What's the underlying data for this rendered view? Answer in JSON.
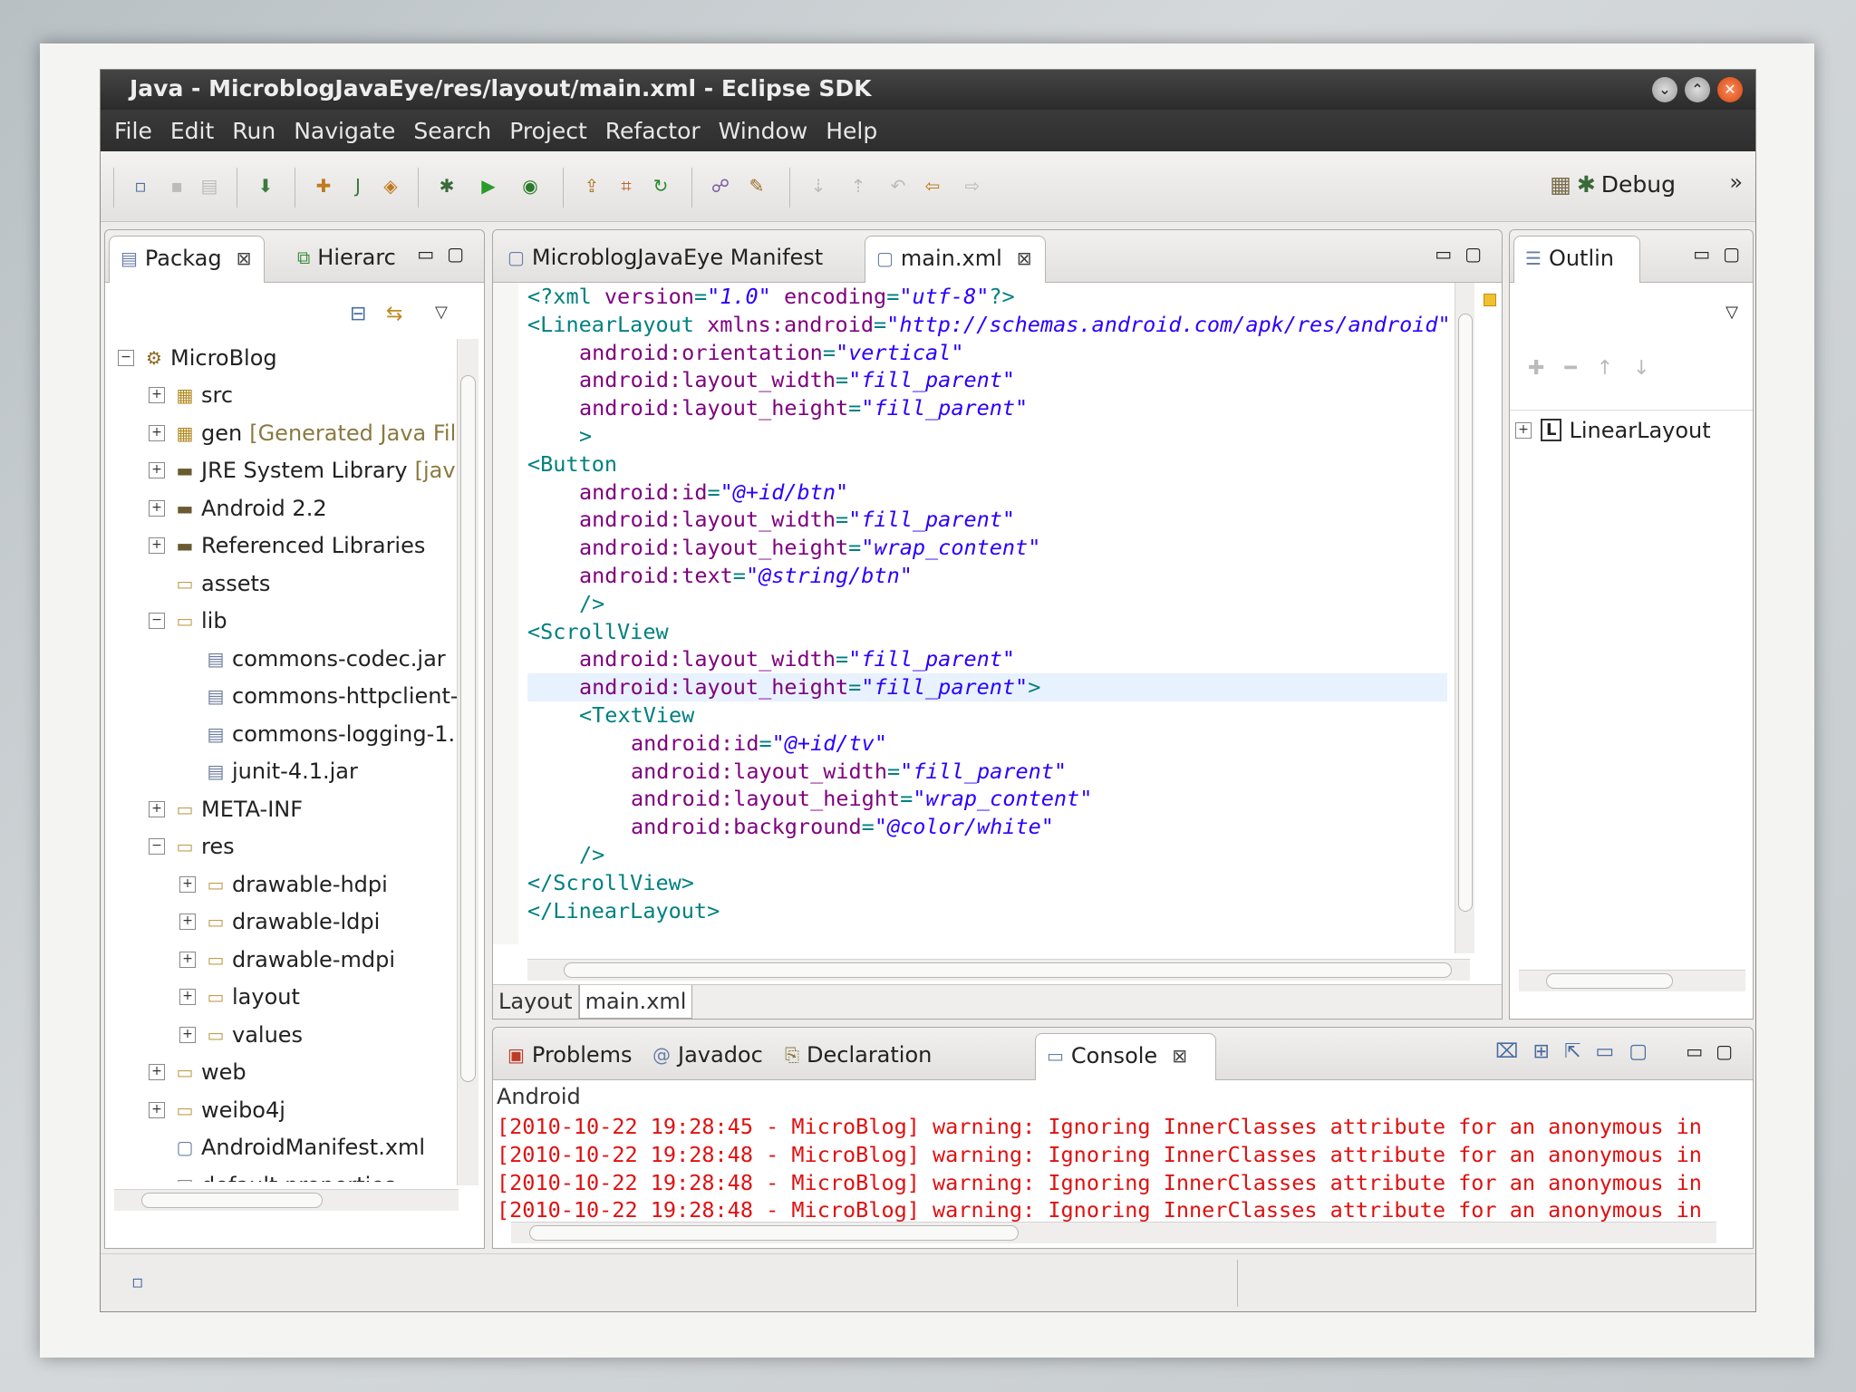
{
  "window": {
    "title": "Java - MicroblogJavaEye/res/layout/main.xml - Eclipse SDK",
    "controls": [
      "⌄",
      "⌃",
      "✕"
    ]
  },
  "menu": [
    "File",
    "Edit",
    "Run",
    "Navigate",
    "Search",
    "Project",
    "Refactor",
    "Window",
    "Help"
  ],
  "toolbar": {
    "perspective": "Debug",
    "more": "»"
  },
  "left_panel": {
    "tabs": [
      "Packag",
      "Hierarc"
    ],
    "tree": [
      {
        "label": "MicroBlog",
        "depth": 0,
        "toggle": "−",
        "icon": "project-icon"
      },
      {
        "label": "src",
        "depth": 1,
        "toggle": "+",
        "icon": "package-folder-icon"
      },
      {
        "label": "gen",
        "suffix": "[Generated Java Fil",
        "depth": 1,
        "toggle": "+",
        "icon": "package-folder-icon"
      },
      {
        "label": "JRE System Library",
        "suffix": "[jav",
        "depth": 1,
        "toggle": "+",
        "icon": "library-icon"
      },
      {
        "label": "Android 2.2",
        "depth": 1,
        "toggle": "+",
        "icon": "library-icon"
      },
      {
        "label": "Referenced Libraries",
        "depth": 1,
        "toggle": "+",
        "icon": "library-icon"
      },
      {
        "label": "assets",
        "depth": 1,
        "toggle": "",
        "icon": "folder-icon"
      },
      {
        "label": "lib",
        "depth": 1,
        "toggle": "−",
        "icon": "folder-icon"
      },
      {
        "label": "commons-codec.jar",
        "depth": 2,
        "toggle": "",
        "icon": "jar-icon"
      },
      {
        "label": "commons-httpclient-",
        "depth": 2,
        "toggle": "",
        "icon": "jar-icon"
      },
      {
        "label": "commons-logging-1.",
        "depth": 2,
        "toggle": "",
        "icon": "jar-icon"
      },
      {
        "label": "junit-4.1.jar",
        "depth": 2,
        "toggle": "",
        "icon": "jar-icon"
      },
      {
        "label": "META-INF",
        "depth": 1,
        "toggle": "+",
        "icon": "folder-icon"
      },
      {
        "label": "res",
        "depth": 1,
        "toggle": "−",
        "icon": "folder-icon"
      },
      {
        "label": "drawable-hdpi",
        "depth": 2,
        "toggle": "+",
        "icon": "folder-icon"
      },
      {
        "label": "drawable-ldpi",
        "depth": 2,
        "toggle": "+",
        "icon": "folder-icon"
      },
      {
        "label": "drawable-mdpi",
        "depth": 2,
        "toggle": "+",
        "icon": "folder-icon"
      },
      {
        "label": "layout",
        "depth": 2,
        "toggle": "+",
        "icon": "folder-icon"
      },
      {
        "label": "values",
        "depth": 2,
        "toggle": "+",
        "icon": "folder-icon"
      },
      {
        "label": "web",
        "depth": 1,
        "toggle": "+",
        "icon": "folder-icon"
      },
      {
        "label": "weibo4j",
        "depth": 1,
        "toggle": "+",
        "icon": "folder-icon"
      },
      {
        "label": "AndroidManifest.xml",
        "depth": 1,
        "toggle": "",
        "icon": "xml-file-icon"
      },
      {
        "label": "default.properties",
        "depth": 1,
        "toggle": "",
        "icon": "file-icon"
      }
    ]
  },
  "editor": {
    "tabs": [
      "MicroblogJavaEye Manifest",
      "main.xml"
    ],
    "bottom_tabs": [
      "Layout",
      "main.xml"
    ],
    "lines": [
      {
        "indent": 0,
        "parts": [
          [
            "tag",
            "<?xml "
          ],
          [
            "attr",
            "version"
          ],
          [
            "tag",
            "="
          ],
          [
            "val",
            "\"1.0\""
          ],
          [
            "tag",
            " "
          ],
          [
            "attr",
            "encoding"
          ],
          [
            "tag",
            "="
          ],
          [
            "val",
            "\"utf-8\""
          ],
          [
            "tag",
            "?>"
          ]
        ]
      },
      {
        "indent": 0,
        "parts": [
          [
            "tag",
            "<LinearLayout "
          ],
          [
            "attr",
            "xmlns:android"
          ],
          [
            "tag",
            "="
          ],
          [
            "val",
            "\"http://schemas.android.com/apk/res/android\""
          ]
        ]
      },
      {
        "indent": 1,
        "parts": [
          [
            "attr",
            "android:orientation"
          ],
          [
            "tag",
            "="
          ],
          [
            "val",
            "\"vertical\""
          ]
        ]
      },
      {
        "indent": 1,
        "parts": [
          [
            "attr",
            "android:layout_width"
          ],
          [
            "tag",
            "="
          ],
          [
            "val",
            "\"fill_parent\""
          ]
        ]
      },
      {
        "indent": 1,
        "parts": [
          [
            "attr",
            "android:layout_height"
          ],
          [
            "tag",
            "="
          ],
          [
            "val",
            "\"fill_parent\""
          ]
        ]
      },
      {
        "indent": 1,
        "parts": [
          [
            "tag",
            ">"
          ]
        ]
      },
      {
        "indent": 0,
        "parts": [
          [
            "tag",
            "<Button"
          ]
        ]
      },
      {
        "indent": 1,
        "parts": [
          [
            "attr",
            "android:id"
          ],
          [
            "tag",
            "="
          ],
          [
            "val",
            "\"@+id/btn\""
          ]
        ]
      },
      {
        "indent": 1,
        "parts": [
          [
            "attr",
            "android:layout_width"
          ],
          [
            "tag",
            "="
          ],
          [
            "val",
            "\"fill_parent\""
          ]
        ]
      },
      {
        "indent": 1,
        "parts": [
          [
            "attr",
            "android:layout_height"
          ],
          [
            "tag",
            "="
          ],
          [
            "val",
            "\"wrap_content\""
          ]
        ]
      },
      {
        "indent": 1,
        "parts": [
          [
            "attr",
            "android:text"
          ],
          [
            "tag",
            "="
          ],
          [
            "val",
            "\"@string/btn\""
          ]
        ]
      },
      {
        "indent": 1,
        "parts": [
          [
            "tag",
            "/>"
          ]
        ]
      },
      {
        "indent": 0,
        "parts": [
          [
            "tag",
            "<ScrollView"
          ]
        ]
      },
      {
        "indent": 1,
        "parts": [
          [
            "attr",
            "android:layout_width"
          ],
          [
            "tag",
            "="
          ],
          [
            "val",
            "\"fill_parent\""
          ]
        ]
      },
      {
        "indent": 1,
        "hl": true,
        "parts": [
          [
            "attr",
            "android:layout_height"
          ],
          [
            "tag",
            "="
          ],
          [
            "val",
            "\"fill_parent\""
          ],
          [
            "tag",
            ">"
          ]
        ]
      },
      {
        "indent": 1,
        "parts": [
          [
            "tag",
            "<TextView"
          ]
        ]
      },
      {
        "indent": 2,
        "parts": [
          [
            "attr",
            "android:id"
          ],
          [
            "tag",
            "="
          ],
          [
            "val",
            "\"@+id/tv\""
          ]
        ]
      },
      {
        "indent": 2,
        "parts": [
          [
            "attr",
            "android:layout_width"
          ],
          [
            "tag",
            "="
          ],
          [
            "val",
            "\"fill_parent\""
          ]
        ]
      },
      {
        "indent": 2,
        "parts": [
          [
            "attr",
            "android:layout_height"
          ],
          [
            "tag",
            "="
          ],
          [
            "val",
            "\"wrap_content\""
          ]
        ]
      },
      {
        "indent": 2,
        "parts": [
          [
            "attr",
            "android:background"
          ],
          [
            "tag",
            "="
          ],
          [
            "val",
            "\"@color/white\""
          ]
        ]
      },
      {
        "indent": 1,
        "parts": [
          [
            "tag",
            "/>"
          ]
        ]
      },
      {
        "indent": 0,
        "parts": [
          [
            "tag",
            "</ScrollView>"
          ]
        ]
      },
      {
        "indent": 0,
        "parts": [
          [
            "tag",
            "</LinearLayout>"
          ]
        ]
      }
    ]
  },
  "outline_panel": {
    "tab": "Outlin",
    "tree_item": "LinearLayout",
    "tree_icon_letter": "L"
  },
  "bottom_panel": {
    "tabs": [
      "Problems",
      "Javadoc",
      "Declaration",
      "Console"
    ],
    "console_title": "Android",
    "lines": [
      "[2010-10-22 19:28:45 - MicroBlog] warning: Ignoring InnerClasses attribute for an anonymous in",
      "[2010-10-22 19:28:48 - MicroBlog] warning: Ignoring InnerClasses attribute for an anonymous in",
      "[2010-10-22 19:28:48 - MicroBlog] warning: Ignoring InnerClasses attribute for an anonymous in",
      "[2010-10-22 19:28:48 - MicroBlog] warning: Ignoring InnerClasses attribute for an anonymous in"
    ]
  },
  "colors": {
    "xml_tag": "#008080",
    "xml_attr": "#7f007f",
    "xml_value": "#2a00ff",
    "console_error": "#e01010",
    "current_line": "#e8f2fe"
  }
}
